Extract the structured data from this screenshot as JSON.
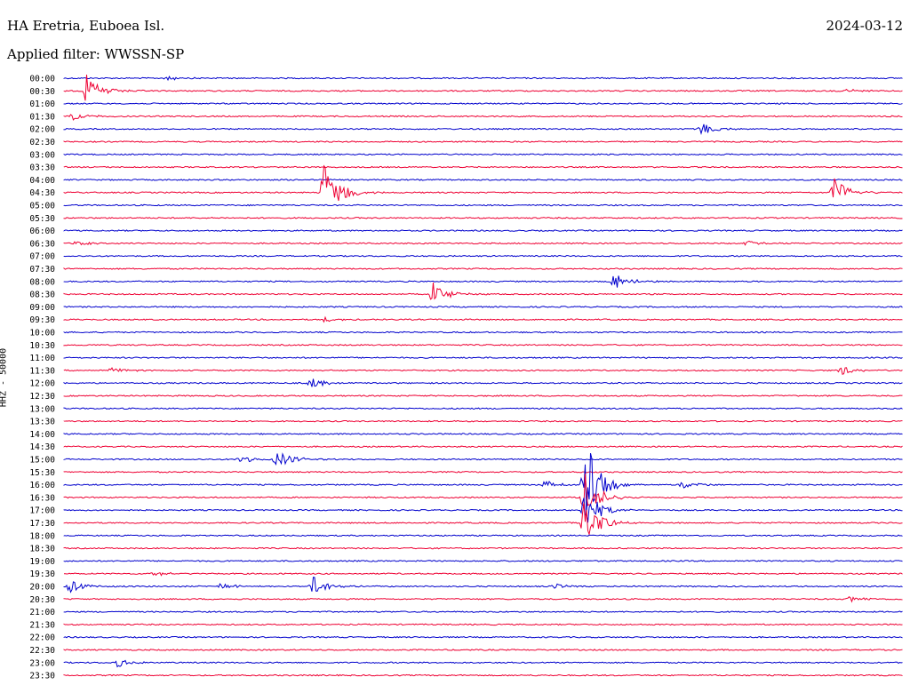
{
  "header": {
    "station": "HA Eretria, Euboea Isl.",
    "date": "2024-03-12",
    "filter": "Applied filter: WWSSN-SP",
    "channel_label": "HHZ - 50000"
  },
  "colors": {
    "blue": "#0000cc",
    "red": "#ee0033"
  },
  "chart_data": {
    "type": "line",
    "title": "HA Eretria, Euboea Isl.",
    "ylabel": "HHZ - 50000",
    "rows": [
      "00:00",
      "00:30",
      "01:00",
      "01:30",
      "02:00",
      "02:30",
      "03:00",
      "03:30",
      "04:00",
      "04:30",
      "05:00",
      "05:30",
      "06:00",
      "06:30",
      "07:00",
      "07:30",
      "08:00",
      "08:30",
      "09:00",
      "09:30",
      "10:00",
      "10:30",
      "11:00",
      "11:30",
      "12:00",
      "12:30",
      "13:00",
      "13:30",
      "14:00",
      "14:30",
      "15:00",
      "15:30",
      "16:00",
      "16:30",
      "17:00",
      "17:30",
      "18:00",
      "18:30",
      "19:00",
      "19:30",
      "20:00",
      "20:30",
      "21:00",
      "21:30",
      "22:00",
      "22:30",
      "23:00",
      "23:30"
    ],
    "row_colors": "alternating blue/red",
    "events": [
      {
        "row": "00:00",
        "minute": 3.6,
        "amplitude": 3
      },
      {
        "row": "00:30",
        "minute": 0.8,
        "amplitude": 18
      },
      {
        "row": "00:30",
        "minute": 28.0,
        "amplitude": 3
      },
      {
        "row": "01:30",
        "minute": 0.3,
        "amplitude": 5
      },
      {
        "row": "02:00",
        "minute": 22.8,
        "amplitude": 7
      },
      {
        "row": "04:30",
        "minute": 9.3,
        "amplitude": 40
      },
      {
        "row": "04:30",
        "minute": 27.5,
        "amplitude": 18
      },
      {
        "row": "06:30",
        "minute": 0.3,
        "amplitude": 3
      },
      {
        "row": "06:30",
        "minute": 24.4,
        "amplitude": 3
      },
      {
        "row": "08:00",
        "minute": 19.6,
        "amplitude": 10
      },
      {
        "row": "08:30",
        "minute": 13.2,
        "amplitude": 14
      },
      {
        "row": "09:30",
        "minute": 9.3,
        "amplitude": 3
      },
      {
        "row": "11:30",
        "minute": 1.7,
        "amplitude": 3
      },
      {
        "row": "11:30",
        "minute": 27.8,
        "amplitude": 5
      },
      {
        "row": "12:00",
        "minute": 8.8,
        "amplitude": 6
      },
      {
        "row": "15:00",
        "minute": 6.3,
        "amplitude": 5
      },
      {
        "row": "15:00",
        "minute": 7.6,
        "amplitude": 12
      },
      {
        "row": "16:00",
        "minute": 17.2,
        "amplitude": 6
      },
      {
        "row": "16:00",
        "minute": 18.6,
        "amplitude": 60
      },
      {
        "row": "16:00",
        "minute": 22.1,
        "amplitude": 5
      },
      {
        "row": "16:30",
        "minute": 18.6,
        "amplitude": 30
      },
      {
        "row": "17:00",
        "minute": 18.6,
        "amplitude": 25
      },
      {
        "row": "17:30",
        "minute": 18.6,
        "amplitude": 30
      },
      {
        "row": "19:30",
        "minute": 3.2,
        "amplitude": 3
      },
      {
        "row": "20:00",
        "minute": 0.2,
        "amplitude": 8
      },
      {
        "row": "20:00",
        "minute": 5.6,
        "amplitude": 4
      },
      {
        "row": "20:00",
        "minute": 8.9,
        "amplitude": 12
      },
      {
        "row": "20:00",
        "minute": 17.5,
        "amplitude": 3
      },
      {
        "row": "20:30",
        "minute": 28.1,
        "amplitude": 4
      },
      {
        "row": "23:00",
        "minute": 1.9,
        "amplitude": 5
      }
    ],
    "xlim": [
      0,
      30
    ],
    "grid": false
  }
}
